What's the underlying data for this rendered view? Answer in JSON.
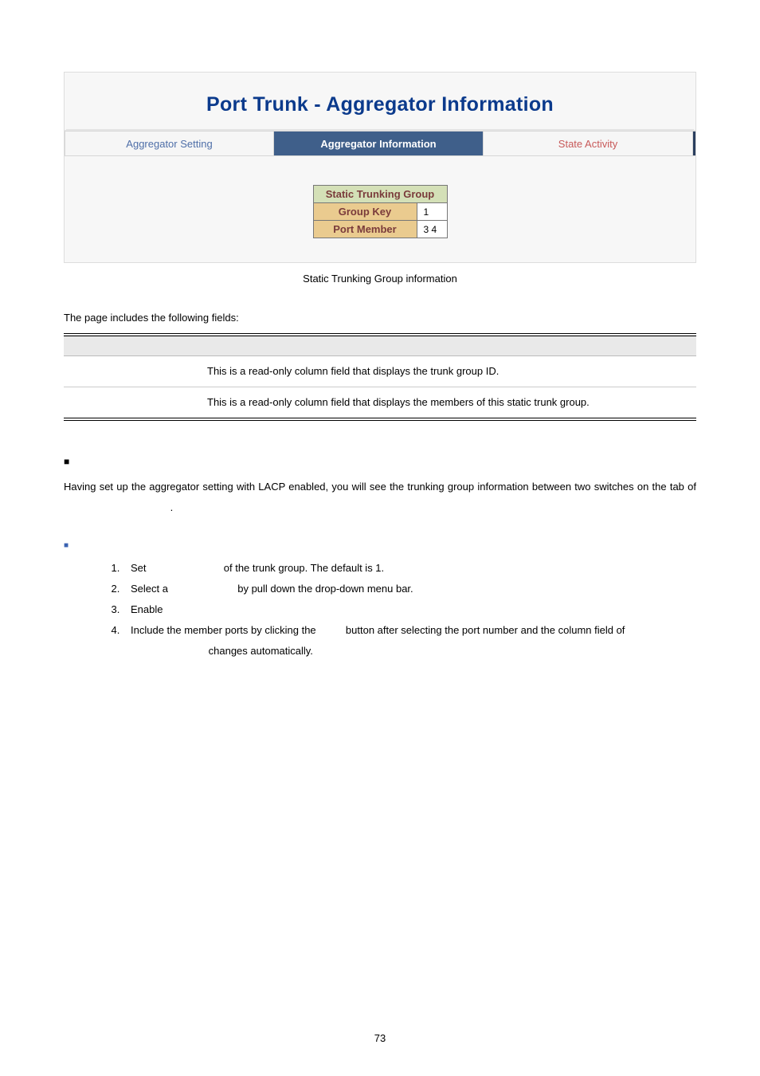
{
  "panel": {
    "title": "Port Trunk - Aggregator Information",
    "tabs": {
      "aggregator_setting": "Aggregator Setting",
      "aggregator_information": "Aggregator Information",
      "state_activity": "State Activity"
    },
    "static_table": {
      "title": "Static Trunking Group",
      "rows": {
        "group_key_label": "Group Key",
        "group_key_value": "1",
        "port_member_label": "Port Member",
        "port_member_value": "3 4"
      }
    }
  },
  "caption": "Static Trunking Group information",
  "fields_intro": "The page includes the following fields:",
  "fields_table": {
    "rows": [
      {
        "desc": "This is a read-only column field that displays the trunk group ID."
      },
      {
        "desc": "This is a read-only column field that displays the members of this static trunk group."
      }
    ]
  },
  "section_text_1": "Having set up the aggregator setting with LACP enabled, you will see the trunking group information between two switches on the tab of",
  "section_text_1_end": ".",
  "steps": {
    "s1_a": "Set",
    "s1_b": "of the trunk group. The default is 1.",
    "s2_a": "Select a",
    "s2_b": "by pull down the drop-down menu bar.",
    "s3_a": "Enable",
    "s4_a": "Include the member ports by clicking the",
    "s4_b": "button after selecting the port number and the column field of",
    "s4_c": "changes automatically."
  },
  "page_number": "73"
}
